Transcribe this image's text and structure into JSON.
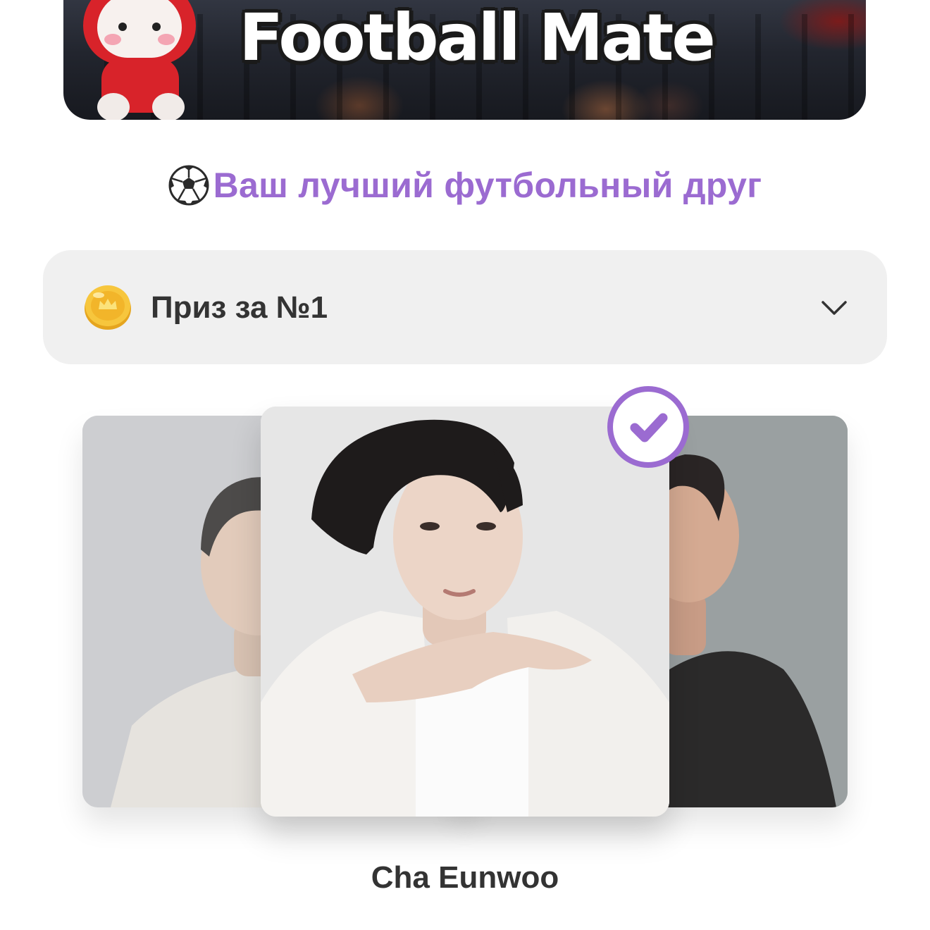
{
  "banner": {
    "title": "Football Mate"
  },
  "subtitle": {
    "text": "Ваш лучший футбольный друг",
    "icon": "soccer-ball-icon",
    "color": "#9b6bd1"
  },
  "prize_select": {
    "label": "Приз за №1",
    "icon": "gold-coin-icon",
    "chevron": "chevron-down-icon"
  },
  "carousel": {
    "selected_index": 1,
    "items": [
      {
        "image": "portrait-left"
      },
      {
        "image": "portrait-center"
      },
      {
        "image": "portrait-right"
      }
    ],
    "selected_badge_icon": "check-circle-icon",
    "selected_name": "Cha Eunwoo"
  },
  "colors": {
    "accent": "#9b6bd1",
    "panel": "#f0f0f0",
    "text": "#333333"
  }
}
